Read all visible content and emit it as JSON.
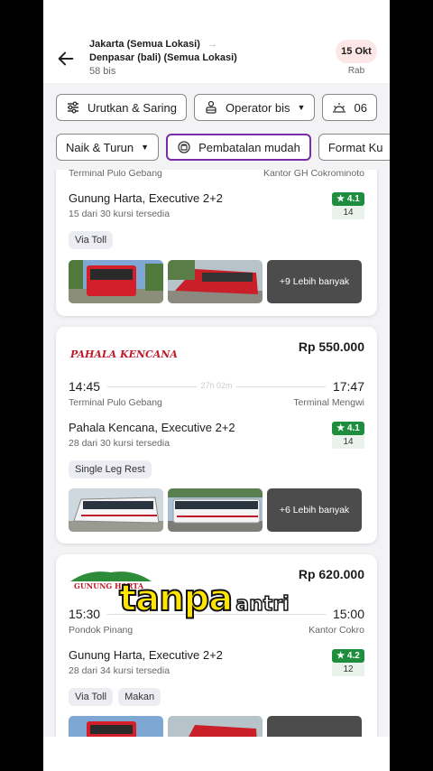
{
  "header": {
    "origin": "Jakarta (Semua Lokasi)",
    "destination": "Denpasar (bali) (Semua Lokasi)",
    "count": "58 bis",
    "date": "15 Okt",
    "day": "Rab"
  },
  "filters_row1": [
    {
      "label": "Urutkan & Saring",
      "icon": "sliders-icon"
    },
    {
      "label": "Operator bis",
      "icon": "bus-operator-icon"
    },
    {
      "label": "06",
      "icon": "sunrise-icon"
    }
  ],
  "filters_row2": [
    {
      "label": "Naik & Turun"
    },
    {
      "label": "Pembatalan mudah",
      "icon": "easy-cancel-icon"
    },
    {
      "label": "Format Ku"
    }
  ],
  "cards": [
    {
      "from_stop": "Terminal Pulo Gebang",
      "to_stop": "Kantor GH Cokrominoto",
      "operator": "Gunung Harta, Executive 2+2",
      "seats": "15 dari 30 kursi tersedia",
      "rating": "★ 4.1",
      "reviews": "14",
      "tags": [
        "Via Toll"
      ],
      "more_photos": "+9 Lebih banyak"
    },
    {
      "logo": "PAHALA KENCANA",
      "price": "Rp 550.000",
      "depart": "14:45",
      "arrive": "17:47",
      "duration": "27h 02m",
      "from_stop": "Terminal Pulo Gebang",
      "to_stop": "Terminal Mengwi",
      "operator": "Pahala Kencana, Executive 2+2",
      "seats": "28 dari 30 kursi tersedia",
      "rating": "★ 4.1",
      "reviews": "14",
      "tags": [
        "Single Leg Rest"
      ],
      "more_photos": "+6 Lebih banyak"
    },
    {
      "logo": "GUNUNG HARTA",
      "price": "Rp 620.000",
      "depart": "15:30",
      "arrive": "15:00",
      "from_stop": "Pondok Pinang",
      "to_stop": "Kantor Cokro",
      "operator": "Gunung Harta, Executive 2+2",
      "seats": "28 dari 34 kursi tersedia",
      "rating": "★ 4.2",
      "reviews": "12",
      "tags": [
        "Via Toll",
        "Makan"
      ]
    }
  ],
  "overlay": {
    "big": "tanpa",
    "small": "antri"
  },
  "colors": {
    "accent": "#7a2ba8",
    "rating": "#1e8e3e",
    "date_pill": "#fde6e6",
    "brand_red": "#c0182b"
  }
}
